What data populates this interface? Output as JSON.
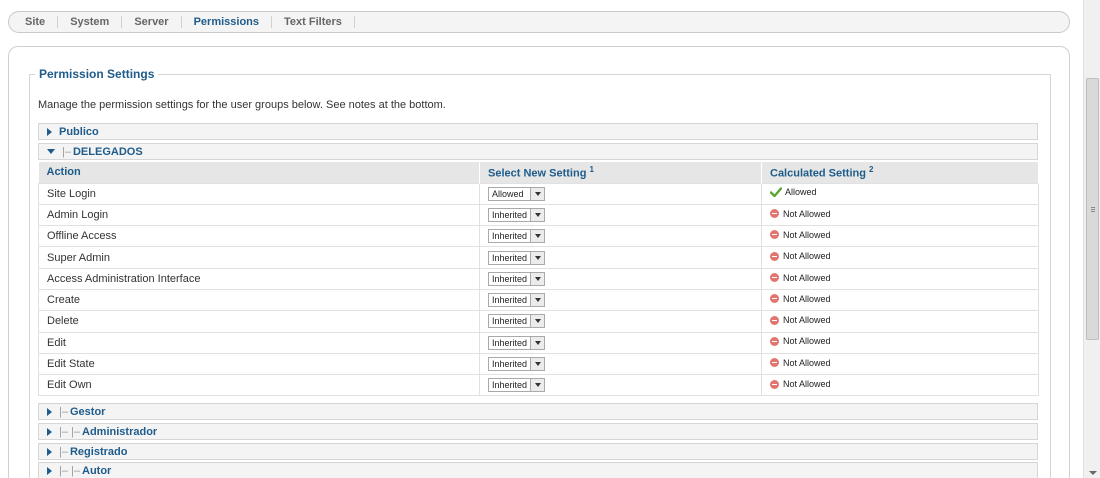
{
  "tabs": [
    "Site",
    "System",
    "Server",
    "Permissions",
    "Text Filters"
  ],
  "active_tab": "Permissions",
  "section": {
    "legend": "Permission Settings",
    "intro": "Manage the permission settings for the user groups below. See notes at the bottom."
  },
  "groups_above": [
    {
      "label": "Publico",
      "prefix": "",
      "expanded": false
    },
    {
      "label": "DELEGADOS",
      "prefix": "|–",
      "expanded": true
    }
  ],
  "table": {
    "headers": {
      "action": "Action",
      "select": "Select New Setting",
      "select_note": "1",
      "calc": "Calculated Setting",
      "calc_note": "2"
    },
    "rows": [
      {
        "action": "Site Login",
        "setting": "Allowed",
        "calculated": "Allowed",
        "allowed": true
      },
      {
        "action": "Admin Login",
        "setting": "Inherited",
        "calculated": "Not Allowed",
        "allowed": false
      },
      {
        "action": "Offline Access",
        "setting": "Inherited",
        "calculated": "Not Allowed",
        "allowed": false
      },
      {
        "action": "Super Admin",
        "setting": "Inherited",
        "calculated": "Not Allowed",
        "allowed": false
      },
      {
        "action": "Access Administration Interface",
        "setting": "Inherited",
        "calculated": "Not Allowed",
        "allowed": false
      },
      {
        "action": "Create",
        "setting": "Inherited",
        "calculated": "Not Allowed",
        "allowed": false
      },
      {
        "action": "Delete",
        "setting": "Inherited",
        "calculated": "Not Allowed",
        "allowed": false
      },
      {
        "action": "Edit",
        "setting": "Inherited",
        "calculated": "Not Allowed",
        "allowed": false
      },
      {
        "action": "Edit State",
        "setting": "Inherited",
        "calculated": "Not Allowed",
        "allowed": false
      },
      {
        "action": "Edit Own",
        "setting": "Inherited",
        "calculated": "Not Allowed",
        "allowed": false
      }
    ]
  },
  "groups_below": [
    {
      "label": "Gestor",
      "prefix": "|–"
    },
    {
      "label": "Administrador",
      "prefix": "|– |–"
    },
    {
      "label": "Registrado",
      "prefix": "|–"
    },
    {
      "label": "Autor",
      "prefix": "|– |–"
    }
  ],
  "colors": {
    "accent": "#1f5c8b",
    "allowed": "#5aa532",
    "not_allowed": "#e2756e"
  }
}
